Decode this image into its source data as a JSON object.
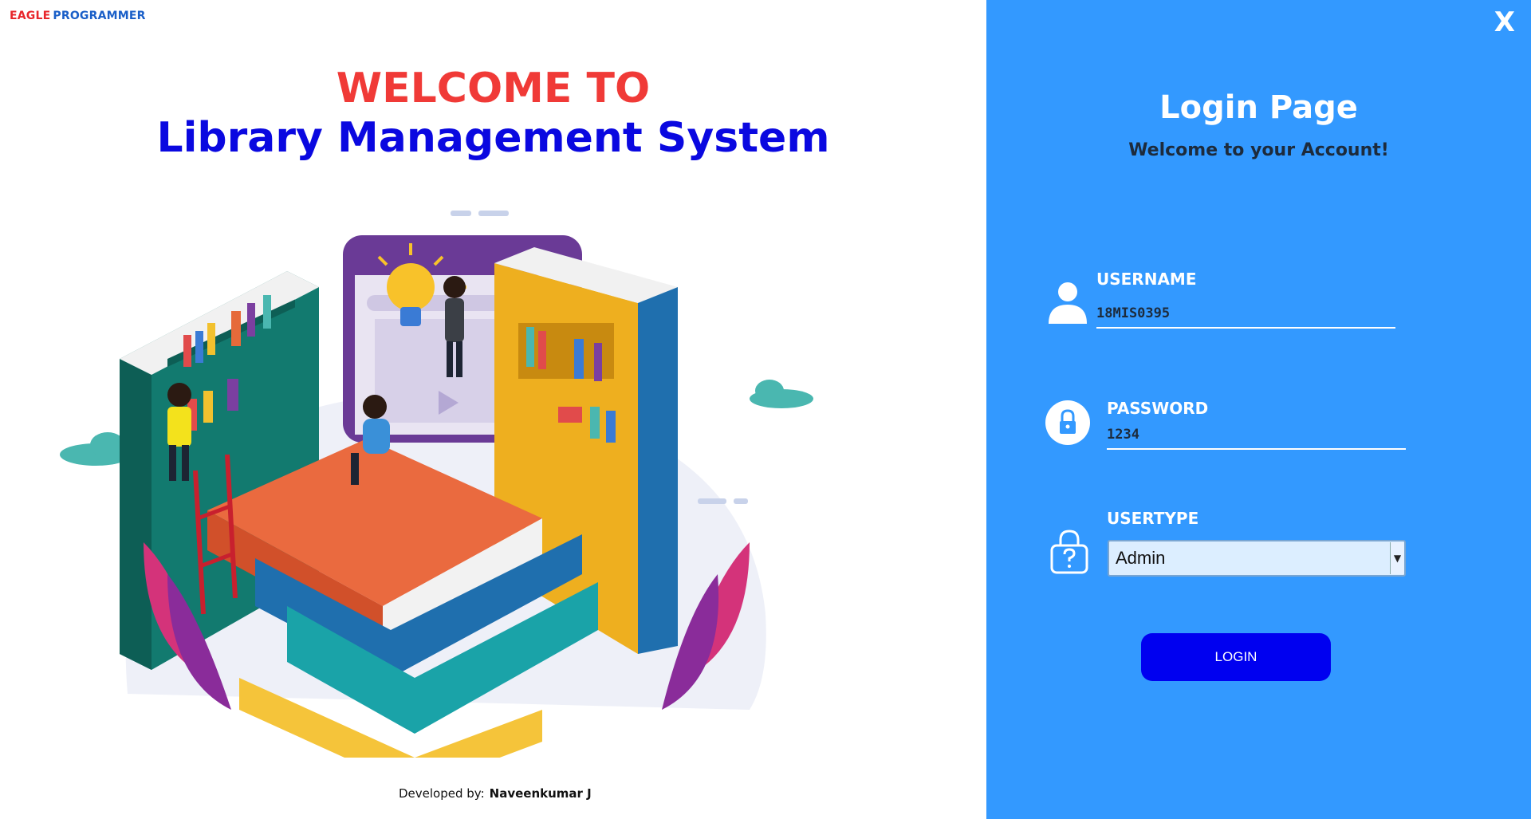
{
  "brand": {
    "part1": "EAGLE",
    "part2": "PROGRAMMER",
    "color1": "#e8262b",
    "color2": "#1a5fc8"
  },
  "welcome": {
    "line1": "WELCOME TO",
    "line2": "Library Management System"
  },
  "footer": {
    "label": "Developed by:",
    "name": "Naveenkumar J"
  },
  "login": {
    "close_label": "X",
    "title": "Login Page",
    "subtitle": "Welcome to your Account!",
    "username": {
      "label": "USERNAME",
      "value": "18MIS0395",
      "icon": "user-icon"
    },
    "password": {
      "label": "PASSWORD",
      "value": "1234",
      "icon": "lock-icon"
    },
    "usertype": {
      "label": "USERTYPE",
      "selected": "Admin",
      "icon": "question-lock-icon"
    },
    "button_label": "LOGIN"
  },
  "colors": {
    "panel": "#3399ff",
    "button": "#0000f0",
    "title_red": "#f03a37",
    "title_blue": "#0a08e0"
  }
}
